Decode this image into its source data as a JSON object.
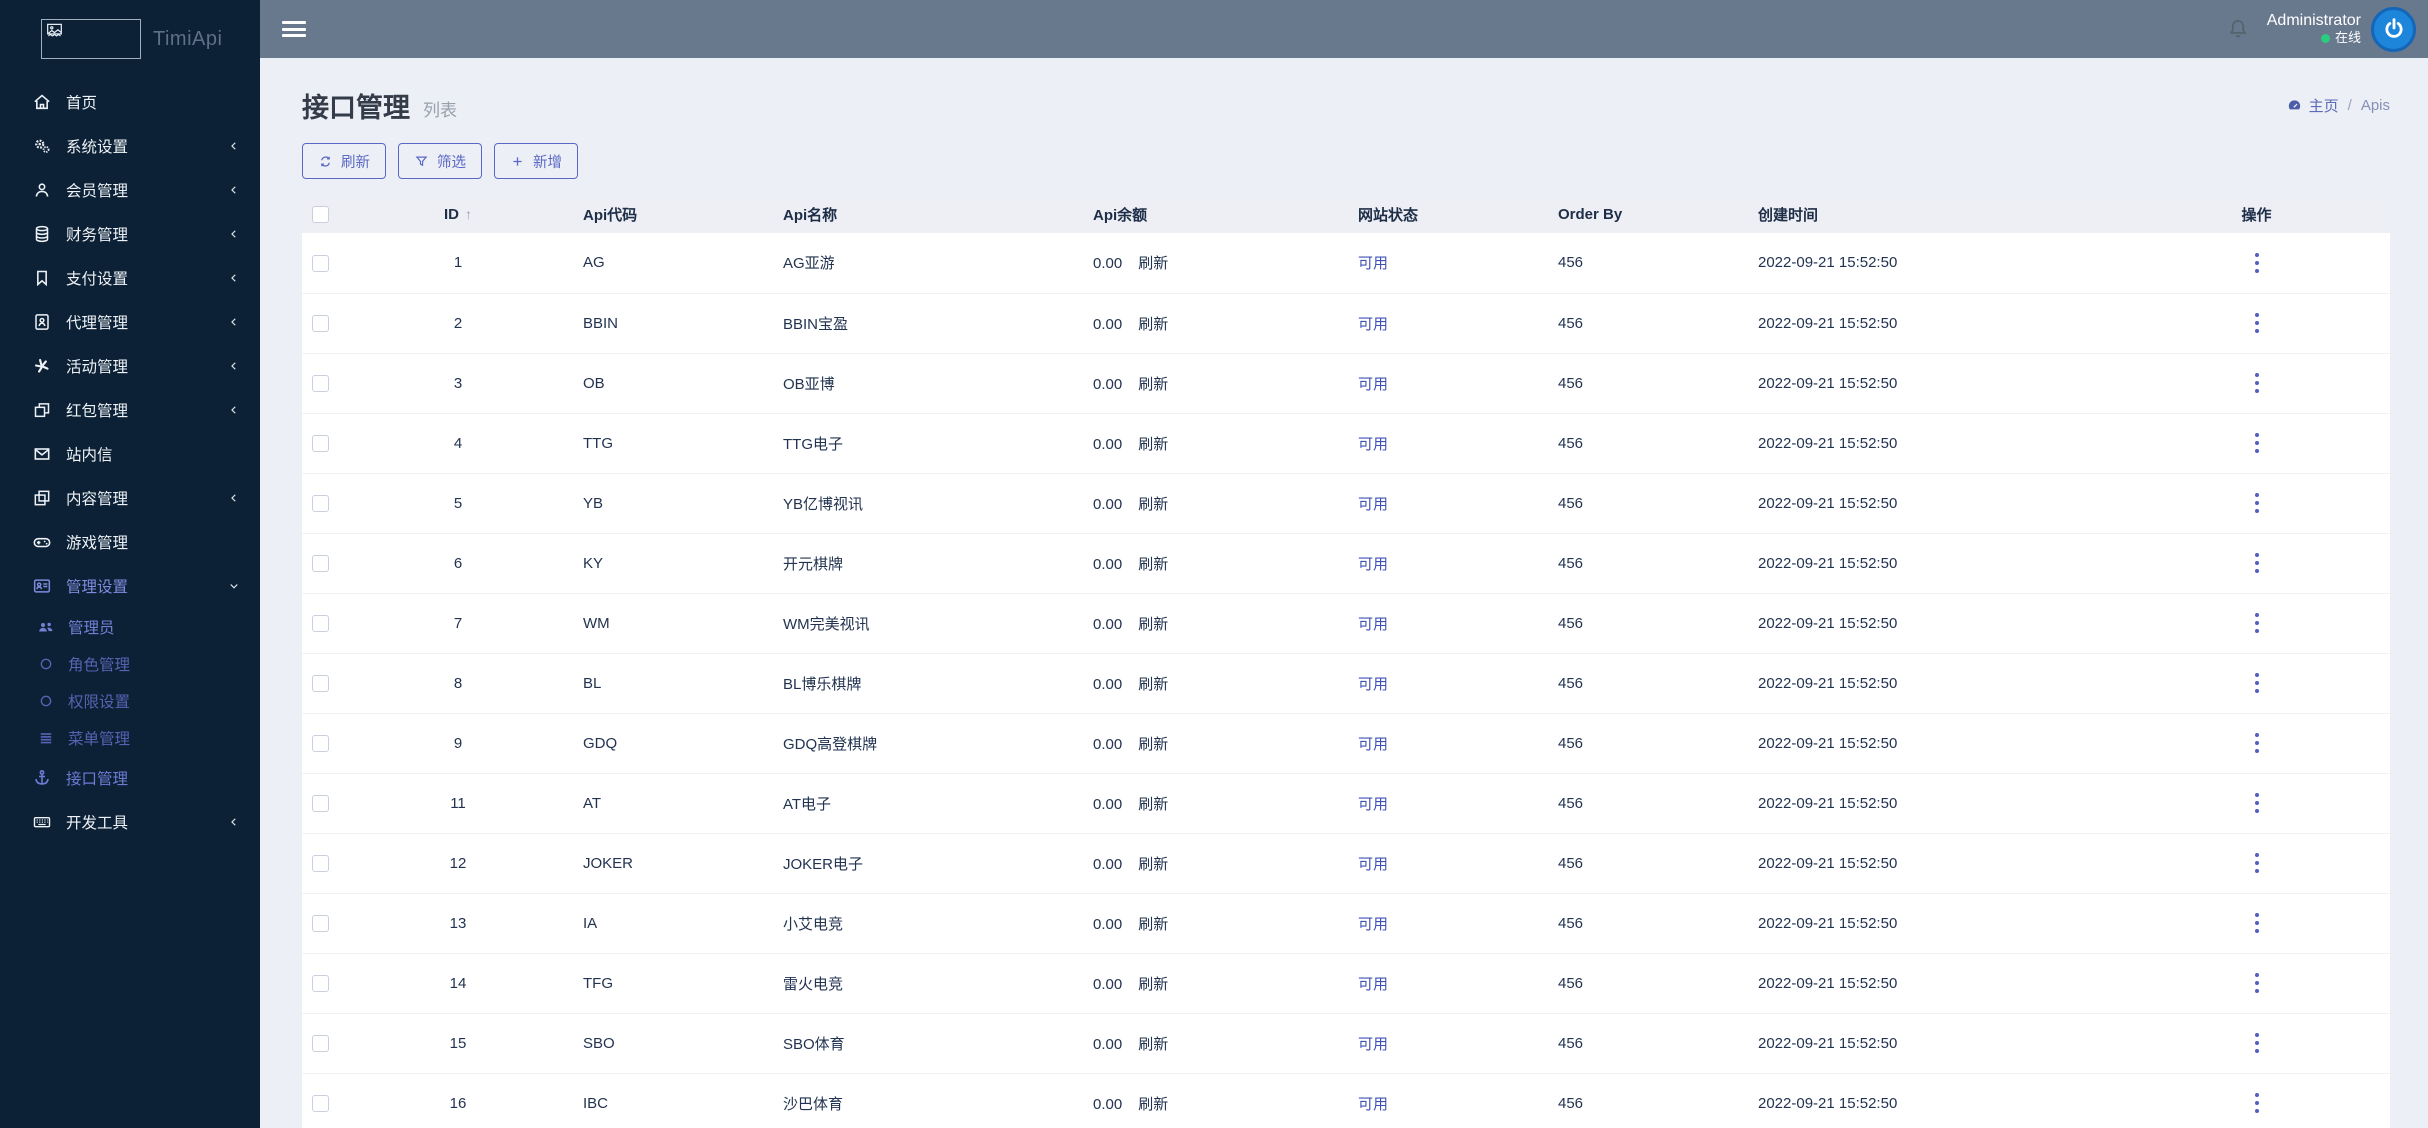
{
  "app": {
    "logo_text": "TimiApi"
  },
  "topbar": {
    "user_name": "Administrator",
    "user_status": "在线"
  },
  "page": {
    "title": "接口管理",
    "subtitle": "列表",
    "breadcrumb": {
      "home": "主页",
      "separator": "/",
      "current": "Apis"
    }
  },
  "toolbar": {
    "refresh_label": "刷新",
    "filter_label": "筛选",
    "add_label": "新增"
  },
  "sidebar": {
    "items": [
      {
        "label": "首页"
      },
      {
        "label": "系统设置"
      },
      {
        "label": "会员管理"
      },
      {
        "label": "财务管理"
      },
      {
        "label": "支付设置"
      },
      {
        "label": "代理管理"
      },
      {
        "label": "活动管理"
      },
      {
        "label": "红包管理"
      },
      {
        "label": "站内信"
      },
      {
        "label": "内容管理"
      },
      {
        "label": "游戏管理"
      },
      {
        "label": "管理设置"
      },
      {
        "label": "管理员"
      },
      {
        "label": "角色管理"
      },
      {
        "label": "权限设置"
      },
      {
        "label": "菜单管理"
      },
      {
        "label": "接口管理"
      },
      {
        "label": "开发工具"
      }
    ]
  },
  "table": {
    "headers": [
      "ID",
      "Api代码",
      "Api名称",
      "Api余额",
      "网站状态",
      "Order By",
      "创建时间",
      "操作"
    ],
    "sort_arrow": "↑",
    "refresh_link": "刷新",
    "rows": [
      {
        "id": "1",
        "code": "AG",
        "name": "AG亚游",
        "balance": "0.00",
        "status": "可用",
        "order": "456",
        "created": "2022-09-21 15:52:50"
      },
      {
        "id": "2",
        "code": "BBIN",
        "name": "BBIN宝盈",
        "balance": "0.00",
        "status": "可用",
        "order": "456",
        "created": "2022-09-21 15:52:50"
      },
      {
        "id": "3",
        "code": "OB",
        "name": "OB亚博",
        "balance": "0.00",
        "status": "可用",
        "order": "456",
        "created": "2022-09-21 15:52:50"
      },
      {
        "id": "4",
        "code": "TTG",
        "name": "TTG电子",
        "balance": "0.00",
        "status": "可用",
        "order": "456",
        "created": "2022-09-21 15:52:50"
      },
      {
        "id": "5",
        "code": "YB",
        "name": "YB亿博视讯",
        "balance": "0.00",
        "status": "可用",
        "order": "456",
        "created": "2022-09-21 15:52:50"
      },
      {
        "id": "6",
        "code": "KY",
        "name": "开元棋牌",
        "balance": "0.00",
        "status": "可用",
        "order": "456",
        "created": "2022-09-21 15:52:50"
      },
      {
        "id": "7",
        "code": "WM",
        "name": "WM完美视讯",
        "balance": "0.00",
        "status": "可用",
        "order": "456",
        "created": "2022-09-21 15:52:50"
      },
      {
        "id": "8",
        "code": "BL",
        "name": "BL博乐棋牌",
        "balance": "0.00",
        "status": "可用",
        "order": "456",
        "created": "2022-09-21 15:52:50"
      },
      {
        "id": "9",
        "code": "GDQ",
        "name": "GDQ高登棋牌",
        "balance": "0.00",
        "status": "可用",
        "order": "456",
        "created": "2022-09-21 15:52:50"
      },
      {
        "id": "11",
        "code": "AT",
        "name": "AT电子",
        "balance": "0.00",
        "status": "可用",
        "order": "456",
        "created": "2022-09-21 15:52:50"
      },
      {
        "id": "12",
        "code": "JOKER",
        "name": "JOKER电子",
        "balance": "0.00",
        "status": "可用",
        "order": "456",
        "created": "2022-09-21 15:52:50"
      },
      {
        "id": "13",
        "code": "IA",
        "name": "小艾电竞",
        "balance": "0.00",
        "status": "可用",
        "order": "456",
        "created": "2022-09-21 15:52:50"
      },
      {
        "id": "14",
        "code": "TFG",
        "name": "雷火电竞",
        "balance": "0.00",
        "status": "可用",
        "order": "456",
        "created": "2022-09-21 15:52:50"
      },
      {
        "id": "15",
        "code": "SBO",
        "name": "SBO体育",
        "balance": "0.00",
        "status": "可用",
        "order": "456",
        "created": "2022-09-21 15:52:50"
      },
      {
        "id": "16",
        "code": "IBC",
        "name": "沙巴体育",
        "balance": "0.00",
        "status": "可用",
        "order": "456",
        "created": "2022-09-21 15:52:50"
      }
    ]
  },
  "colors": {
    "sidebar_bg": "#0c2135",
    "topbar_bg": "#68798e",
    "page_bg": "#edeff6",
    "accent_indigo": "#5a68c4",
    "status_blue": "#3f51b5",
    "online_green": "#2bcc80",
    "avatar_blue": "#1e86da"
  }
}
